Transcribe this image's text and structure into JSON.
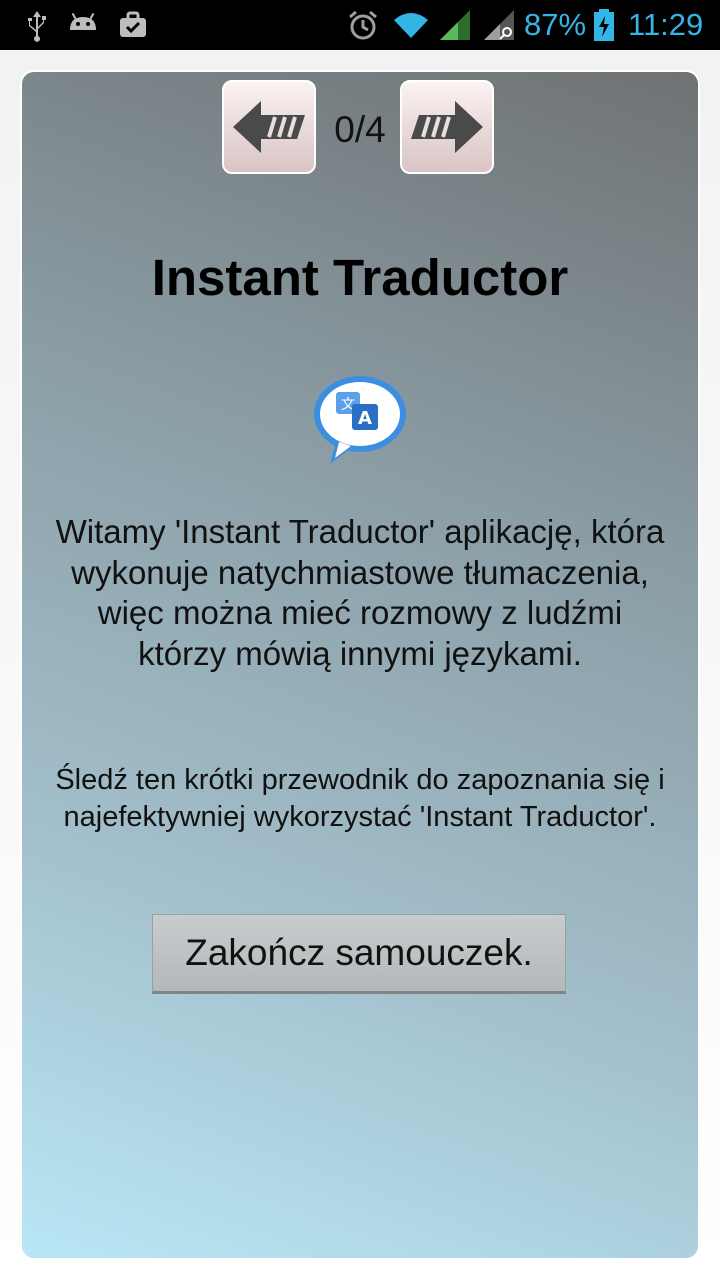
{
  "statusbar": {
    "battery_percent": "87%",
    "time": "11:29",
    "accent_color": "#33b5e5",
    "left_icons": [
      "usb-icon",
      "android-debug-icon",
      "briefcase-icon"
    ],
    "right_icons": [
      "alarm-icon",
      "wifi-icon",
      "signal-icon",
      "signal-roaming-icon",
      "battery-charging-icon"
    ]
  },
  "tutorial": {
    "prev_icon": "arrow-left-icon",
    "next_icon": "arrow-right-icon",
    "counter": "0/4",
    "title": "Instant Traductor",
    "app_icon": "translate-bubble-icon",
    "welcome_text": "Witamy 'Instant Traductor' aplikację, która wykonuje natychmiastowe tłumaczenia, więc można mieć rozmowy z ludźmi którzy mówią innymi językami.",
    "guide_text": "Śledź ten krótki przewodnik do zapoznania się i najefektywniej wykorzystać 'Instant Traductor'.",
    "end_button_label": "Zakończ samouczek."
  }
}
